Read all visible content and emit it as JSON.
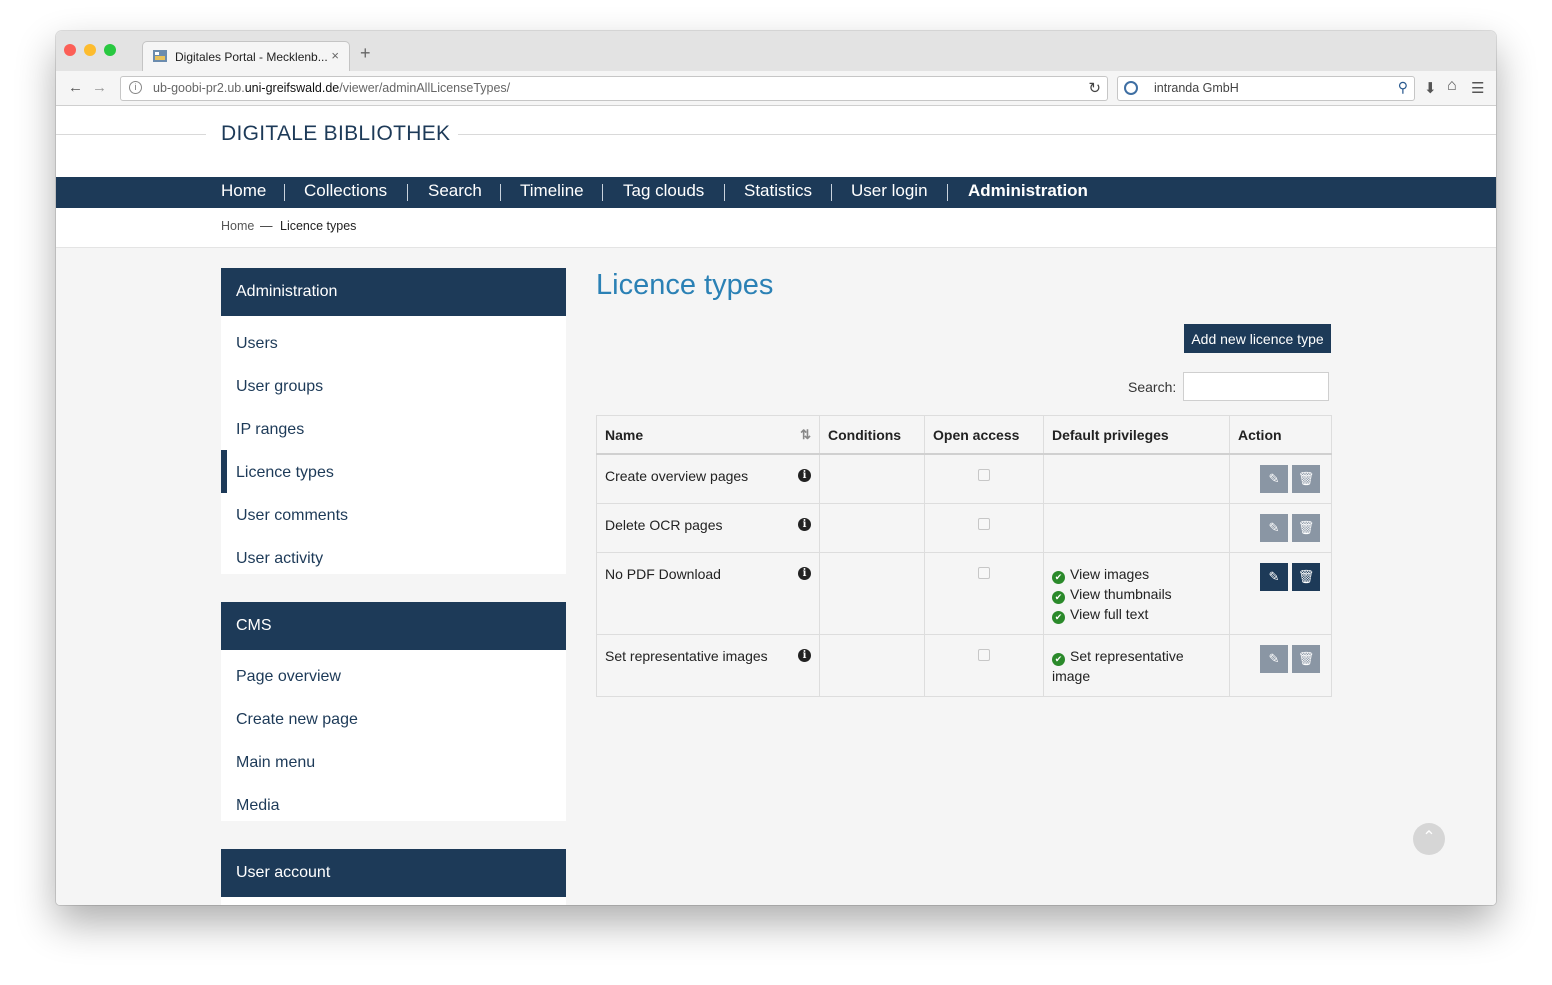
{
  "browser": {
    "tab_title": "Digitales Portal - Mecklenb...",
    "tab_close": "×",
    "new_tab": "+",
    "url_host_prefix": "ub-goobi-pr2.ub.",
    "url_domain": "uni-greifswald.de",
    "url_path": "/viewer/adminAllLicenseTypes/",
    "search_text": "intranda GmbH"
  },
  "site": {
    "logo": "DIGITALE BIBLIOTHEK"
  },
  "nav": {
    "items": [
      "Home",
      "Collections",
      "Search",
      "Timeline",
      "Tag clouds",
      "Statistics",
      "User login",
      "Administration"
    ]
  },
  "breadcrumb": {
    "home": "Home",
    "separator": "—",
    "current": "Licence types"
  },
  "sidebar": {
    "admin": {
      "title": "Administration",
      "items": [
        "Users",
        "User groups",
        "IP ranges",
        "Licence types",
        "User comments",
        "User activity"
      ],
      "active_index": 3
    },
    "cms": {
      "title": "CMS",
      "items": [
        "Page overview",
        "Create new page",
        "Main menu",
        "Media"
      ]
    },
    "account": {
      "title": "User account"
    }
  },
  "main": {
    "title": "Licence types",
    "add_button": "Add new licence type",
    "search_label": "Search:",
    "search_value": "",
    "table": {
      "headers": [
        "Name",
        "Conditions",
        "Open access",
        "Default privileges",
        "Action"
      ],
      "rows": [
        {
          "name": "Create overview pages",
          "conditions": "",
          "open_access": false,
          "privileges": []
        },
        {
          "name": "Delete OCR pages",
          "conditions": "",
          "open_access": false,
          "privileges": []
        },
        {
          "name": "No PDF Download",
          "conditions": "",
          "open_access": false,
          "privileges": [
            "View images",
            "View thumbnails",
            "View full text"
          ]
        },
        {
          "name": "Set representative images",
          "conditions": "",
          "open_access": false,
          "privileges": [
            "Set representative image"
          ]
        }
      ]
    }
  },
  "colors": {
    "brand": "#1d3a58",
    "title_blue": "#2b81b5",
    "check_green": "#2b8a2b",
    "button_grey": "#8a96a4"
  },
  "icons": [
    "info-icon",
    "sort-icon",
    "check-circle-icon",
    "pencil-icon",
    "trash-icon",
    "scroll-top-icon"
  ]
}
